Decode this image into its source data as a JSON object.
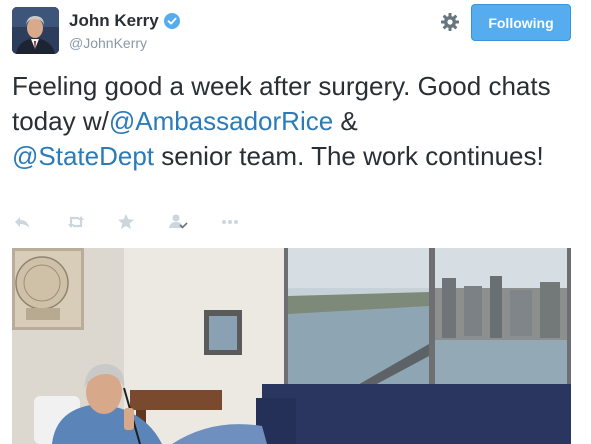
{
  "author": {
    "name": "John Kerry",
    "handle": "@JohnKerry",
    "verified": true
  },
  "header": {
    "settings_icon": "gear-icon",
    "follow_label": "Following",
    "follow_color": "#55acee"
  },
  "tweet": {
    "line1": "Feeling good a week after surgery. Good chats today w/",
    "mention1": "@AmbassadorRice",
    "line2": " & ",
    "mention2": "@StateDept",
    "line3": " senior team. The work continues!"
  },
  "actions": [
    {
      "icon": "reply-icon"
    },
    {
      "icon": "retweet-icon"
    },
    {
      "icon": "favorite-star-icon"
    },
    {
      "icon": "follow-user-icon"
    },
    {
      "icon": "more-options-icon"
    }
  ],
  "colors": {
    "link": "#2b7bb9",
    "text": "#292f33",
    "muted": "#8899a6",
    "action_icon": "#ccd6dd"
  }
}
